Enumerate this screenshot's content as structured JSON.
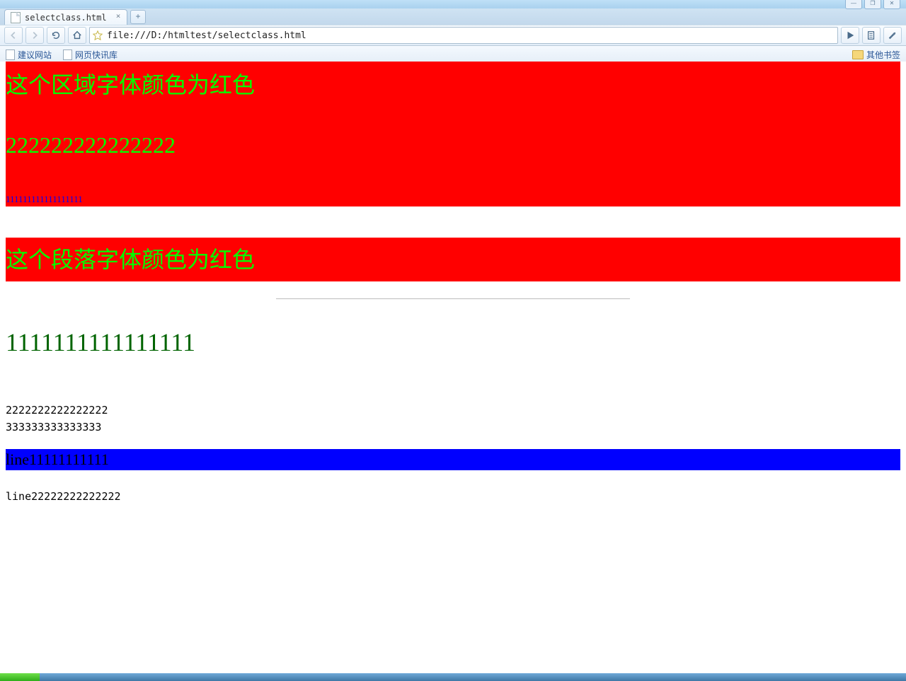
{
  "window": {
    "tab_title": "selectclass.html",
    "min_tip": "—",
    "max_tip": "❐",
    "close_tip": "✕"
  },
  "toolbar": {
    "url": "file:///D:/htmltest/selectclass.html"
  },
  "bookmarks": {
    "item1": "建议网站",
    "item2": "网页快讯库",
    "other": "其他书签"
  },
  "page": {
    "div_h1": "这个区域字体颜色为红色",
    "div_h1b": "222222222222222",
    "div_small": "111111111111111111",
    "p_h1": "这个段落字体颜色为红色",
    "green_line": "1111111111111111",
    "plain2": "2222222222222222",
    "plain3": "333333333333333",
    "blueband": "line11111111111",
    "line2": "line22222222222222"
  }
}
